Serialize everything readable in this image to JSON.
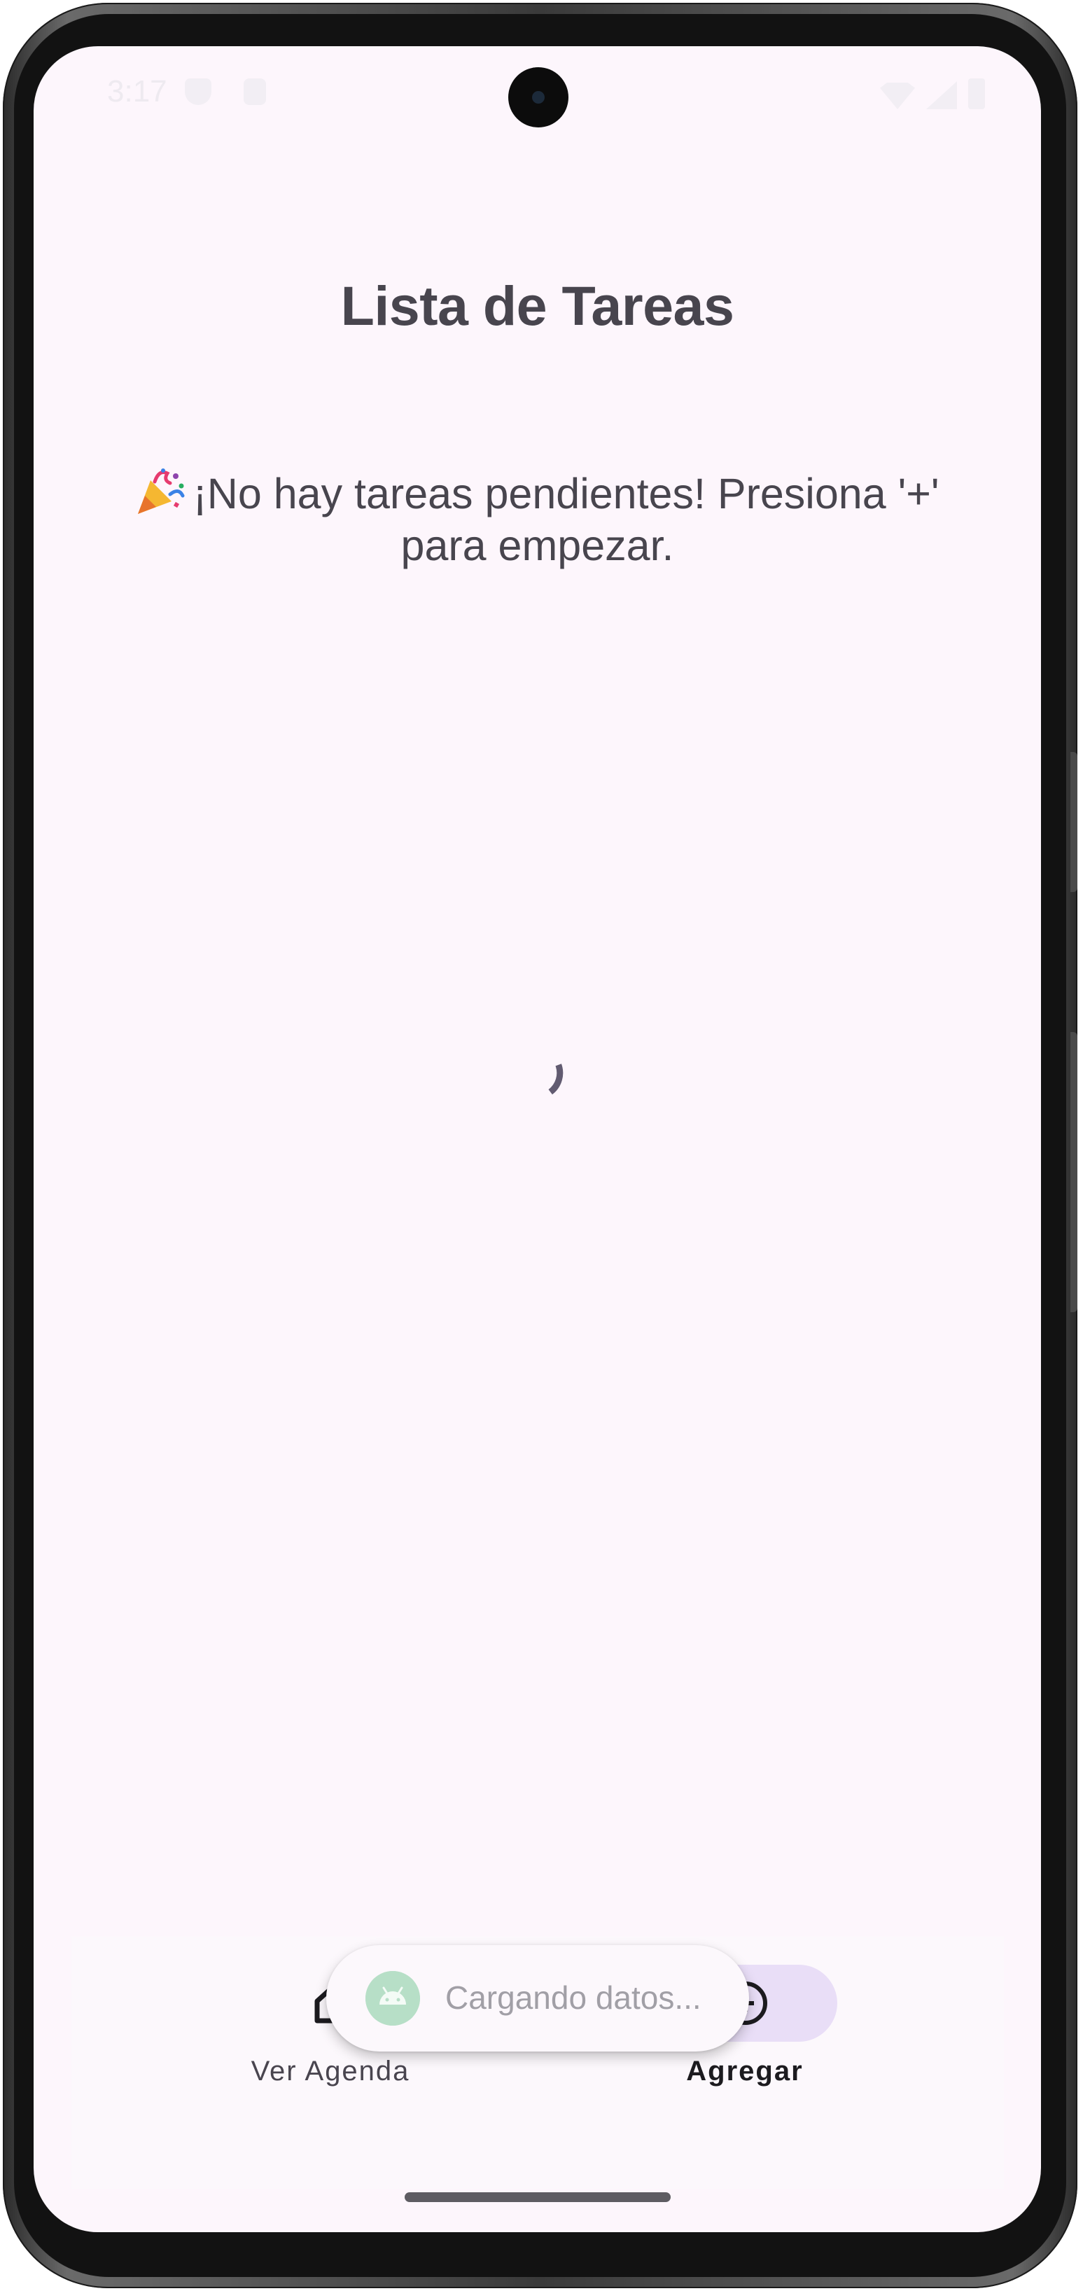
{
  "status_bar": {
    "time": "3:17"
  },
  "app": {
    "title": "Lista de Tareas",
    "empty_state_text": "¡No hay tareas pendientes! Presiona '+' para empezar.",
    "empty_state_icon": "party-popper-icon"
  },
  "bottom_nav": {
    "items": [
      {
        "label": "Ver Agenda",
        "icon": "home-icon",
        "selected": false
      },
      {
        "label": "Agregar",
        "icon": "add-circle-icon",
        "selected": true
      }
    ]
  },
  "toast": {
    "text": "Cargando datos...",
    "icon": "android-icon"
  },
  "colors": {
    "background": "#fdf6fc",
    "title": "#48454e",
    "nav_indicator": "#e9def7",
    "spinner": "#625b71"
  }
}
